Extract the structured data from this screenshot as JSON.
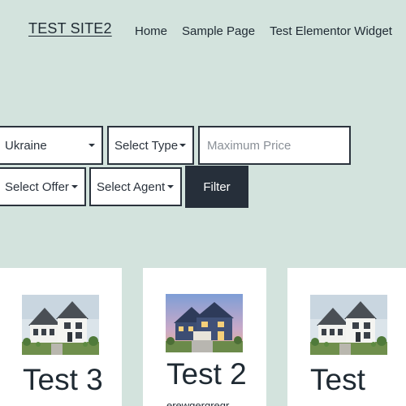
{
  "header": {
    "site_title": "TEST SITE2",
    "nav": [
      "Home",
      "Sample Page",
      "Test Elementor Widget"
    ]
  },
  "filters": {
    "location": "Ukraine",
    "type": "Select Type",
    "max_price_placeholder": "Maximum Price",
    "offer": "Select Offer",
    "agent": "Select Agent",
    "filter_label": "Filter"
  },
  "listings": [
    {
      "title": "Test 3",
      "image": "white-farmhouse"
    },
    {
      "title": "Test 2",
      "image": "blue-house-dusk",
      "excerpt": "erewgergregr"
    },
    {
      "title": "Test",
      "image": "white-farmhouse"
    }
  ],
  "colors": {
    "background": "#d3e3dd",
    "button": "#262f3a",
    "border": "#2b333d"
  }
}
